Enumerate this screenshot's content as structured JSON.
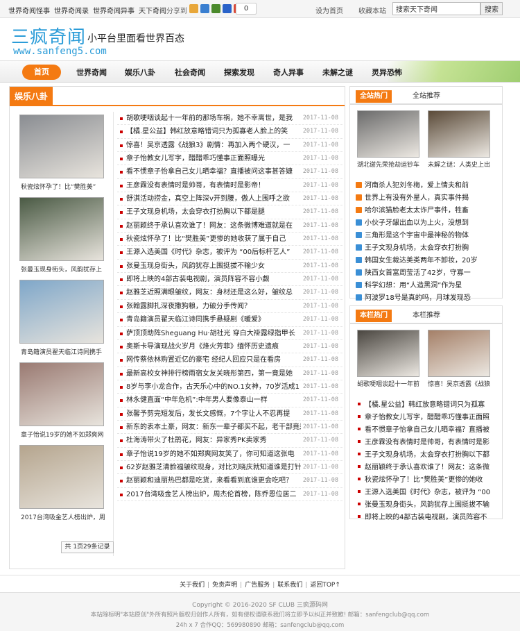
{
  "topbar": {
    "links": [
      "世界奇闻怪事",
      "世界奇闻录",
      "世界奇闻异事",
      "天下奇闻"
    ],
    "share_label": "分享到",
    "share_icon_colors": [
      "#e8a73a",
      "#3a7fd0",
      "#4b8a2c",
      "#2a63c9",
      "#d94a3a"
    ],
    "share_count": "0",
    "set_home": "设为首页",
    "bookmark": "收藏本站",
    "search_value": "搜索天下奇闻",
    "search_button": "搜索"
  },
  "header": {
    "logo": "三疯奇闻",
    "slogan": "小平台里面看世界百态",
    "url": "www.sanfeng5.com"
  },
  "nav": {
    "home": "首页",
    "items": [
      "世界奇闻",
      "娱乐八卦",
      "社会奇闻",
      "探索发现",
      "奇人异事",
      "未解之谜",
      "灵异恐怖"
    ],
    "accent_color": "#f47a12"
  },
  "main": {
    "section_title": "娱乐八卦",
    "thumbs": [
      {
        "caption": "秋瓷炫怀孕了！比“樊胜美”",
        "color": "#8a8d92"
      },
      {
        "caption": "张曼玉现身街头，风韵犹存上",
        "color": "#4a5a44"
      },
      {
        "caption": "青岛籍演员翟天临江诗同携手",
        "color": "#7fa7c9"
      },
      {
        "caption": "章子怡说19岁的她不如郑爽网",
        "color": "#9a7a72"
      },
      {
        "caption": "2017台湾吸金艺人榜出炉，周",
        "color": "#b5a58e"
      }
    ],
    "articles": [
      {
        "title": "胡歌哽咽谈起十一年前的那场车祸，她不幸离世，是我",
        "date": "2017-11-08"
      },
      {
        "title": "【橘.星公益】韩红放意略错词只为孤寡老人脸上的笑",
        "date": "2017-11-08"
      },
      {
        "title": "惊喜！吴京透露《战狼3》剧情：再加入两个硬汉，一",
        "date": "2017-11-08"
      },
      {
        "title": "章子怡教女儿写字，醋醋乖巧懂事正面照曝光",
        "date": "2017-11-08"
      },
      {
        "title": "看不惯章子怡拿自己女儿晒幸福？直播被问这事甚答婕",
        "date": "2017-11-08"
      },
      {
        "title": "王彦霖没有表情时是帅哥，有表情时是影帝！",
        "date": "2017-11-08"
      },
      {
        "title": "舒淇活动捞金，真空上阵深v开到腰，傲人上围呼之欲",
        "date": "2017-11-08"
      },
      {
        "title": "王子文现身机场，太会穿衣打扮胸以下都是腿",
        "date": "2017-11-08"
      },
      {
        "title": "赵丽颖终于承认喜欢谁了！网友：这条微博难道就是在",
        "date": "2017-11-08"
      },
      {
        "title": "秋瓷炫怀孕了！比“樊胜美”更惨的她收获了属于自己",
        "date": "2017-11-08"
      },
      {
        "title": "王源入选美国《时代》杂志，被评为 “00后标杆艺人”",
        "date": "2017-11-08"
      },
      {
        "title": "张曼玉现身街头，风韵犹存上围挺拔不输少女",
        "date": "2017-11-08"
      },
      {
        "title": "即将上映的4部古装电视剧，演员阵容不容小觑",
        "date": "2017-11-08"
      },
      {
        "title": "赵雅芝近照满眼皱纹，网友：身材还是这么好，皱纹总",
        "date": "2017-11-08"
      },
      {
        "title": "张翰露脚扎深夜撒狗粮，力破分手传闻？",
        "date": "2017-11-08"
      },
      {
        "title": "青岛籍演员翟天临江诗同携手悬疑剧《暖爱》",
        "date": "2017-11-08"
      },
      {
        "title": "萨顶顶助阵Sheguang Hu·胡社光 穿白大褂露绿指甲长",
        "date": "2017-11-08"
      },
      {
        "title": "奥斯卡导演现战火岁月《烽火芳菲》缅怀历史遗痕",
        "date": "2017-11-08"
      },
      {
        "title": "网传蔡依林购置近亿的豪宅 经纪人回应只是在看房",
        "date": "2017-11-08"
      },
      {
        "title": "最新高校女神排行榜雨宿女友关晓彤第四，第一竟是她",
        "date": "2017-11-08"
      },
      {
        "title": "8岁与李小龙合作，古天乐心中的NO.1女神，70岁活成1",
        "date": "2017-11-08"
      },
      {
        "title": "林永健直面“中年危机”:中年男人要像泰山一样",
        "date": "2017-11-08"
      },
      {
        "title": "张馨予剪完短发后，发长文感慨，7个字让人不忍再提",
        "date": "2017-11-08"
      },
      {
        "title": "新东的表本土豪，网友：新东一辈子都买不起，老干部竟是隐",
        "date": "2017-11-08"
      },
      {
        "title": "杜海涛带火了杜鹃花，网友：异家秀PK卖家秀",
        "date": "2017-11-08"
      },
      {
        "title": "章子怡说19岁的她不如郑爽网友笑了，你可知道这张电",
        "date": "2017-11-08"
      },
      {
        "title": "62岁赵雅芝清脸福皱纹现身，对比刘晓庆就知道谁是打针",
        "date": "2017-11-08"
      },
      {
        "title": "赵丽颖和迪丽热巴都是吃货，来看看到底谁更会吃吧？",
        "date": "2017-11-08"
      },
      {
        "title": "2017台湾吸金艺人榜出炉，周杰伦首榜，陈乔恩位居二",
        "date": "2017-11-08"
      }
    ],
    "pager": "共 1页29条记录"
  },
  "side1": {
    "tab_active": "全站热门",
    "tab_other": "全站推荐",
    "thumbs": [
      {
        "caption": "湖北谢先荣抢劫运钞车",
        "color": "#6b6b6b"
      },
      {
        "caption": "未解之谜：人类史上出",
        "color": "#5a4a38"
      }
    ],
    "number_colors": [
      "#f47a12",
      "#f47a12",
      "#f47a12",
      "#3a8fd6",
      "#3a8fd6",
      "#3a8fd6",
      "#3a8fd6",
      "#3a8fd6",
      "#3a8fd6",
      "#3a8fd6"
    ],
    "items": [
      "河南杀人犯刘冬梅，爱上情夫和前",
      "世界上有没有外星人，真实事件揭",
      "哈尔滨猫脸老太太诈尸事件，牲畜",
      "小伙子牙龈出血以为上火，没想到",
      "三角形是这个宇宙中最神秘的物体",
      "王子文现身机场，太会穿衣打扮胸",
      "韩国女生裁达美类两年不卸妆，20岁",
      "陕西女首富周莹活了42岁，守寡一",
      "科学幻想：用“人造黑洞”作为星",
      "阿波罗18号是真的吗，月球发现恐"
    ]
  },
  "side2": {
    "tab_active": "本栏热门",
    "tab_other": "本栏推荐",
    "thumbs": [
      {
        "caption": "胡歌哽咽谈起十一年前",
        "color": "#4a4640"
      },
      {
        "caption": "惊喜！吴京透露《战狼",
        "color": "#a58068"
      }
    ],
    "items": [
      "【橘.星公益】韩红放意略错词只为孤寡",
      "章子怡教女儿写字，醋醋乖巧懂事正面照",
      "看不惯章子怡拿自己女儿晒幸福？直播被",
      "王彦霖没有表情时是帅哥，有表情时是影",
      "王子文现身机场，太会穿衣打扮胸以下都",
      "赵丽颖终于承认喜欢谁了！网友：这条微",
      "秋瓷炫怀孕了！比“樊胜美”更惨的她收",
      "王源入选美国《时代》杂志，被评为 “00",
      "张曼玉现身街头，风韵犹存上围挺拔不输",
      "即将上映的4部古装电视剧，演员阵容不"
    ]
  },
  "footer": {
    "links": [
      "关于我们",
      "免责声明",
      "广告服务",
      "联系我们",
      "返回TOP↑"
    ],
    "copyright": "Copyright © 2016-2020 SF CLUB 三疯源码网",
    "notice": "本站除标明\"本站原创\"外所有照片版权归创作人所有，如有侵权请联系我们将立即予以纠正并致歉! 邮箱：sanfengclub@qq.com",
    "contact": "24h x 7 合作QQ：569980890 邮箱：sanfengclub@qq.com"
  }
}
